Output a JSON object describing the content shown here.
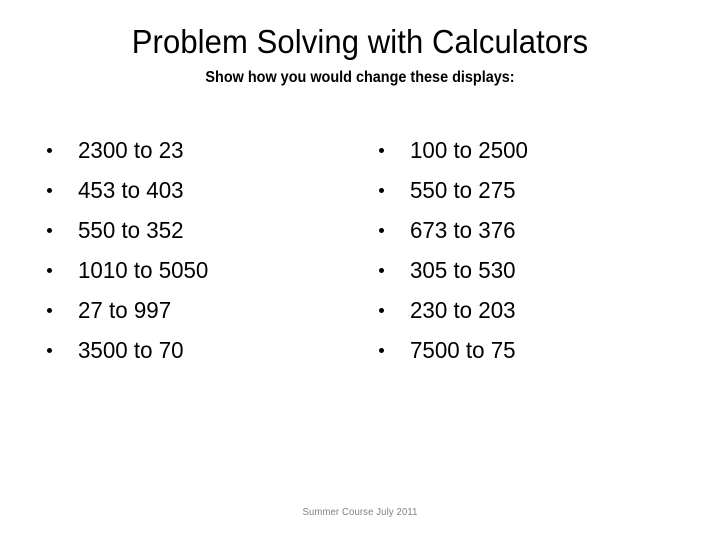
{
  "slide": {
    "title": "Problem Solving with Calculators",
    "subtitle": "Show how you would change these displays:",
    "footer": "Summer Course July 2011",
    "background_color": "#ffffff",
    "text_color": "#000000",
    "footer_color": "#808080",
    "bullet_glyph": "bullet-dot"
  },
  "columns": {
    "left": {
      "items": [
        {
          "label": "2300 to 23"
        },
        {
          "label": "453 to 403"
        },
        {
          "label": "550 to 352"
        },
        {
          "label": "1010 to 5050"
        },
        {
          "label": "27 to 997"
        },
        {
          "label": "3500 to 70"
        }
      ]
    },
    "right": {
      "items": [
        {
          "label": "100 to 2500"
        },
        {
          "label": "550 to 275"
        },
        {
          "label": "673 to 376"
        },
        {
          "label": "305 to 530"
        },
        {
          "label": "230 to 203"
        },
        {
          "label": "7500 to 75"
        }
      ]
    }
  }
}
